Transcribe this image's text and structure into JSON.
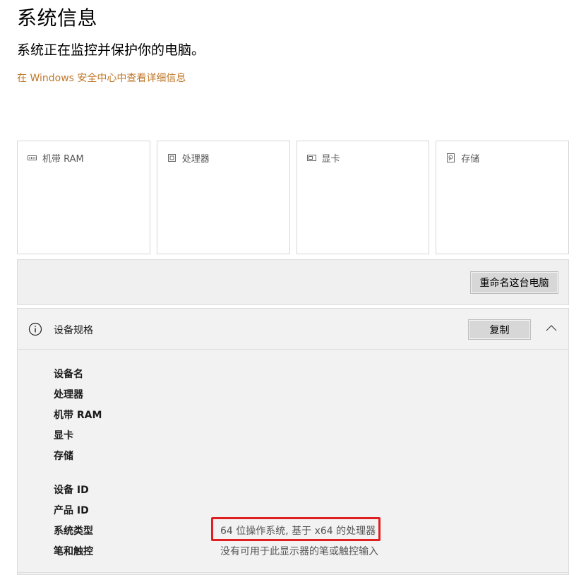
{
  "header": {
    "title": "系统信息",
    "subtitle": "系统正在监控并保护你的电脑。",
    "security_link": "在 Windows 安全中心中查看详细信息"
  },
  "cards": [
    {
      "label": "机带 RAM",
      "icon": "ram-icon"
    },
    {
      "label": "处理器",
      "icon": "cpu-icon"
    },
    {
      "label": "显卡",
      "icon": "gpu-icon"
    },
    {
      "label": "存储",
      "icon": "storage-icon"
    }
  ],
  "rename": {
    "button_label": "重命名这台电脑"
  },
  "specs": {
    "title": "设备规格",
    "copy_label": "复制",
    "rows_group1": [
      {
        "label": "设备名",
        "value": ""
      },
      {
        "label": "处理器",
        "value": ""
      },
      {
        "label": "机带 RAM",
        "value": ""
      },
      {
        "label": "显卡",
        "value": ""
      },
      {
        "label": "存储",
        "value": ""
      }
    ],
    "rows_group2": [
      {
        "label": "设备 ID",
        "value": ""
      },
      {
        "label": "产品 ID",
        "value": ""
      },
      {
        "label": "系统类型",
        "value": "64 位操作系统, 基于 x64 的处理器"
      },
      {
        "label": "笔和触控",
        "value": "没有可用于此显示器的笔或触控输入"
      }
    ]
  },
  "colors": {
    "accent_link": "#c0782a",
    "highlight": "#e02020",
    "panel_bg": "#f2f2f2"
  }
}
